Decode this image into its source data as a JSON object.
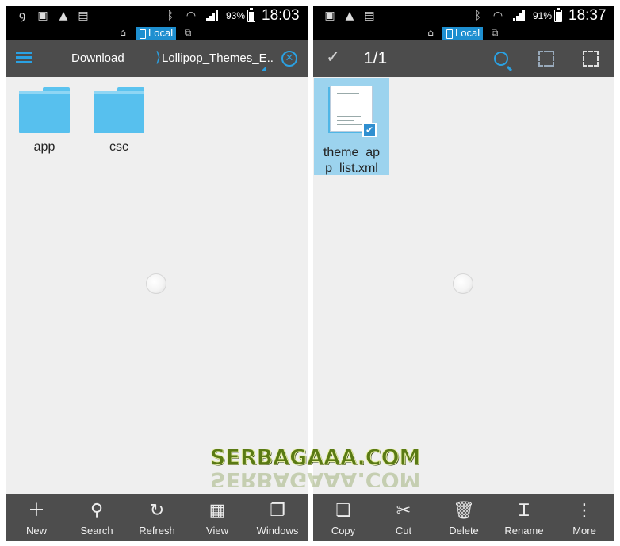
{
  "left_screen": {
    "status": {
      "battery_pct": "93%",
      "time": "18:03"
    },
    "location": {
      "local_label": "Local"
    },
    "toolbar": {
      "crumb_root": "Download",
      "crumb_current": "Lollipop_Themes_E..."
    },
    "items": [
      {
        "name": "app",
        "type": "folder"
      },
      {
        "name": "csc",
        "type": "folder"
      }
    ],
    "bottom_bar": [
      {
        "label": "New",
        "icon": "plus-icon"
      },
      {
        "label": "Search",
        "icon": "search-icon"
      },
      {
        "label": "Refresh",
        "icon": "refresh-icon"
      },
      {
        "label": "View",
        "icon": "grid-view-icon"
      },
      {
        "label": "Windows",
        "icon": "windows-icon"
      }
    ]
  },
  "right_screen": {
    "status": {
      "battery_pct": "91%",
      "time": "18:37"
    },
    "location": {
      "local_label": "Local"
    },
    "toolbar": {
      "selection_count": "1/1"
    },
    "items": [
      {
        "name": "theme_app_list.xml",
        "name_line1": "theme_ap",
        "name_line2": "p_list.xml",
        "type": "xml-file",
        "selected": true
      }
    ],
    "bottom_bar": [
      {
        "label": "Copy",
        "icon": "copy-icon"
      },
      {
        "label": "Cut",
        "icon": "scissors-icon"
      },
      {
        "label": "Delete",
        "icon": "trash-icon"
      },
      {
        "label": "Rename",
        "icon": "rename-icon"
      },
      {
        "label": "More",
        "icon": "more-vertical-icon"
      }
    ]
  },
  "watermark": {
    "text": "SERBAGAAA.COM"
  },
  "colors": {
    "accent": "#2aa1e3",
    "toolbar": "#4c4c4c",
    "folder": "#57c0ee",
    "selection": "#9cd3ee"
  }
}
